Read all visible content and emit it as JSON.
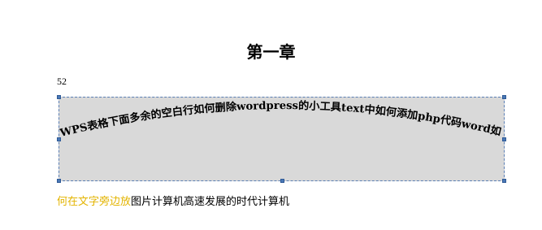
{
  "document": {
    "chapter_title": "第一章",
    "page_number": "52"
  },
  "textbox": {
    "curved_text": "WPS表格下面多余的空白行如何删除wordpress的小工具text中如何添加php代码word如",
    "fill_color": "#d9d9d9",
    "border_color": "#5b7fb4"
  },
  "caption": {
    "highlighted": "何在文字旁边放",
    "rest": "图片计算机高速发展的时代计算机",
    "highlight_color": "#e3b400"
  }
}
